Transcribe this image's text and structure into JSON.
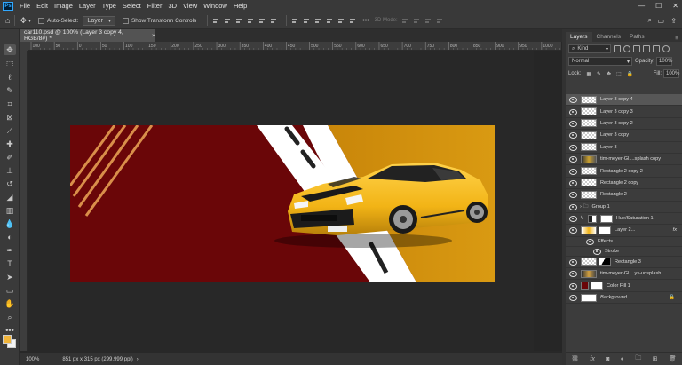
{
  "menubar": {
    "logo": "Ps",
    "items": [
      "File",
      "Edit",
      "Image",
      "Layer",
      "Type",
      "Select",
      "Filter",
      "3D",
      "View",
      "Window",
      "Help"
    ],
    "window_controls": [
      "—",
      "☐",
      "✕"
    ]
  },
  "options": {
    "auto_select_label": "Auto-Select:",
    "auto_select_value": "Layer",
    "transform_label": "Show Transform Controls",
    "mode_3d": "3D Mode:"
  },
  "document": {
    "tab_title": "car110.psd @ 100% (Layer 3 copy 4, RGB/8#) *",
    "tab_close": "×",
    "zoom": "100%",
    "doc_info": "851 px x 315 px (299.999 ppi)",
    "ruler_ticks": [
      "100",
      "50",
      "0",
      "50",
      "100",
      "150",
      "200",
      "250",
      "300",
      "350",
      "400",
      "450",
      "500",
      "550",
      "600",
      "650",
      "700",
      "750",
      "800",
      "850",
      "900",
      "950",
      "1000"
    ]
  },
  "layers_panel": {
    "tabs": [
      "Layers",
      "Channels",
      "Paths"
    ],
    "kind_label": "Kind",
    "blend_mode": "Normal",
    "opacity_label": "Opacity:",
    "opacity_value": "100%",
    "lock_label": "Lock:",
    "fill_label": "Fill:",
    "fill_value": "100%",
    "layers": [
      {
        "name": "Layer 3 copy 4",
        "selected": true
      },
      {
        "name": "Layer 3 copy 3"
      },
      {
        "name": "Layer 3 copy 2"
      },
      {
        "name": "Layer 3 copy"
      },
      {
        "name": "Layer 3"
      },
      {
        "name": "tim-meyer-Gl....splash copy"
      },
      {
        "name": "Rectangle 2 copy 2"
      },
      {
        "name": "Rectangle 2 copy"
      },
      {
        "name": "Rectangle 2"
      },
      {
        "name": "Group 1"
      },
      {
        "name": "Hue/Saturation 1"
      },
      {
        "name": "Layer 2..."
      },
      {
        "name": "Effects"
      },
      {
        "name": "Stroke"
      },
      {
        "name": "Rectangle 3"
      },
      {
        "name": "tim-meyer-Gl....ys-unsplash"
      },
      {
        "name": "Color Fill 1"
      },
      {
        "name": "Background"
      }
    ],
    "fx_label": "fx",
    "bottom_icons": [
      "link-icon",
      "fx-icon",
      "mask-icon",
      "adjustment-icon",
      "folder-icon",
      "new-layer-icon",
      "trash-icon"
    ]
  },
  "colors": {
    "foreground": "#f0b43a",
    "background_swatch": "#f4f4f4",
    "art_red": "#6a0608",
    "art_gold": "#d4900a",
    "car_yellow": "#f2b416"
  }
}
